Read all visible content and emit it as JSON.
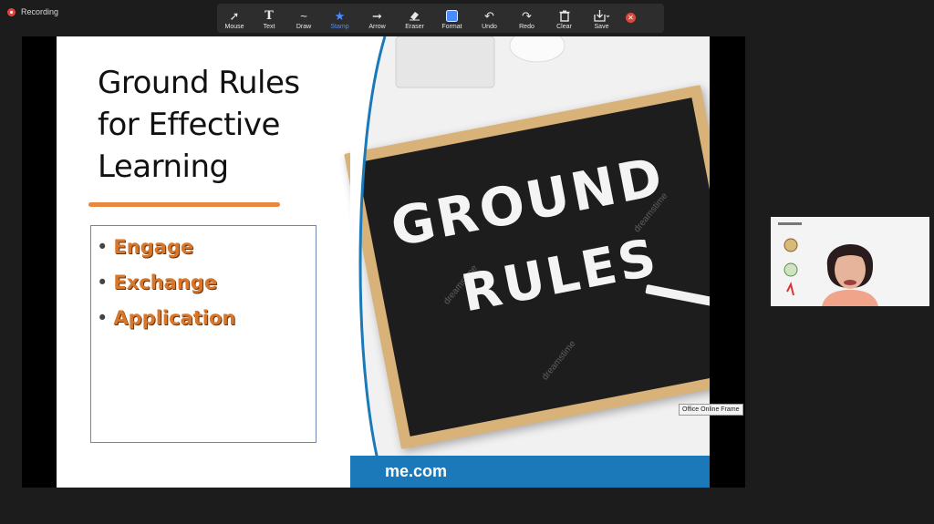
{
  "recording": {
    "label": "Recording"
  },
  "toolbar": {
    "tools": [
      {
        "id": "mouse",
        "label": "Mouse",
        "icon": "cursor-icon",
        "glyph": "➚"
      },
      {
        "id": "text",
        "label": "Text",
        "icon": "text-icon",
        "glyph": "T"
      },
      {
        "id": "draw",
        "label": "Draw",
        "icon": "draw-icon",
        "glyph": "〜"
      },
      {
        "id": "stamp",
        "label": "Stamp",
        "icon": "star-icon",
        "glyph": "★"
      },
      {
        "id": "arrow",
        "label": "Arrow",
        "icon": "arrow-icon",
        "glyph": "➡"
      },
      {
        "id": "eraser",
        "label": "Eraser",
        "icon": "eraser-icon",
        "glyph": "⌫"
      },
      {
        "id": "format",
        "label": "Format",
        "icon": "format-icon",
        "glyph": "■"
      },
      {
        "id": "undo",
        "label": "Undo",
        "icon": "undo-icon",
        "glyph": "↶"
      },
      {
        "id": "redo",
        "label": "Redo",
        "icon": "redo-icon",
        "glyph": "↷"
      },
      {
        "id": "clear",
        "label": "Clear",
        "icon": "trash-icon",
        "glyph": "🗑"
      },
      {
        "id": "save",
        "label": "Save",
        "icon": "save-icon",
        "glyph": "⤓"
      }
    ],
    "active_tool": "Stamp",
    "accent_color": "#4a8cff"
  },
  "slide": {
    "title_line1": "Ground Rules",
    "title_line2": "for Effective",
    "title_line3": "Learning",
    "bullets": [
      "Engage",
      "Exchange",
      "Application"
    ],
    "board_line1": "GROUND",
    "board_line2": "RULES",
    "watermark": "dreamstime",
    "footer_text": "me.com"
  },
  "tooltip": {
    "text": "Office Online Frame"
  },
  "video": {
    "participant": "presenter-video"
  }
}
